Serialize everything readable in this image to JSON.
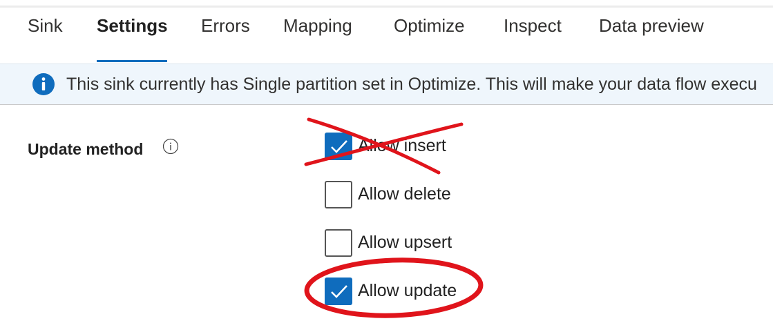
{
  "tabs": [
    "Sink",
    "Settings",
    "Errors",
    "Mapping",
    "Optimize",
    "Inspect",
    "Data preview"
  ],
  "active_tab": "Settings",
  "banner": {
    "icon": "info-icon",
    "text": "This sink currently has Single partition set in Optimize. This will make your data flow execu"
  },
  "update_method": {
    "label": "Update method",
    "info_icon": "info-circle-icon",
    "options": [
      {
        "label": "Allow insert",
        "checked": true
      },
      {
        "label": "Allow delete",
        "checked": false
      },
      {
        "label": "Allow upsert",
        "checked": false
      },
      {
        "label": "Allow update",
        "checked": true
      }
    ]
  },
  "colors": {
    "accent": "#0f6cbd",
    "annotation": "#e0141b",
    "banner_bg": "#eff6fc"
  }
}
